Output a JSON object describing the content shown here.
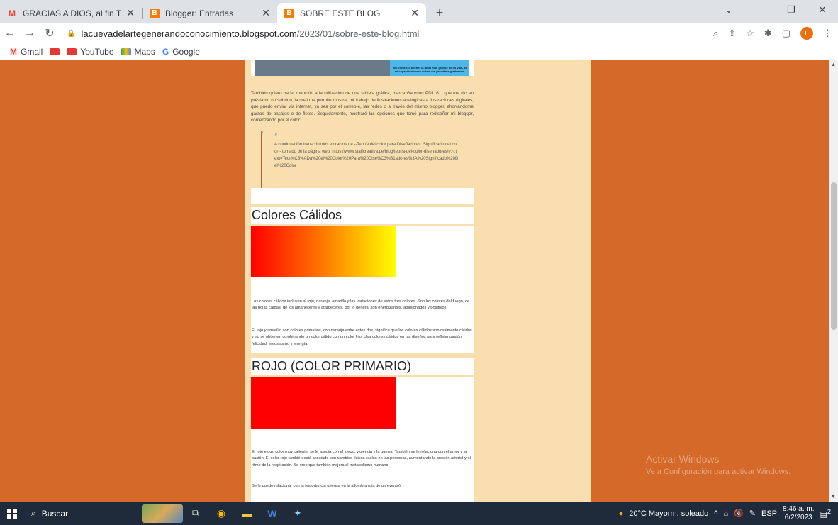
{
  "browser": {
    "tabs": [
      {
        "title": "GRACIAS A DIOS, al fin TDG LEL",
        "favicon": "gmail-icon",
        "active": false
      },
      {
        "title": "Blogger: Entradas",
        "favicon": "blogger-icon",
        "active": false
      },
      {
        "title": "SOBRE ESTE BLOG",
        "favicon": "blogger-icon",
        "active": true
      }
    ],
    "url_host": "lacuevadelartegenerandoconocimiento.blogspot.com",
    "url_path": "/2023/01/sobre-este-blog.html",
    "avatar_letter": "L",
    "bookmarks": [
      "Gmail",
      "YouTube",
      "Maps",
      "Google"
    ]
  },
  "post": {
    "image_caption": "Así comenzó a tener la duda más grande de mi vida, si mi capacidad como artista era permitirle graduarme",
    "intro_paragraph": "También quiero hacer mención a la utilización de una tableta gráfica, marca Gaomon PD1161, que me dio en préstamo un sobrino, la cual me permite mostrar mi trabajo de ilustraciones analógicas a ilustraciones digitales, que puedo enviar vía internet, ya sea por el correo-e, las redes o a través del mismo blogger, ahorrándome gastos de pasajes o de fletes. Seguidamente, mostraré las opciones que tomé para rediseñar mi blogger, comenzando por el color:",
    "quote_text": "A continuación transcribimos extractos de --Teoría del color para Diseñadores. Significado del color-- tomado de la página web: https://www.staffcreativa.pe/blog/teoria-del-color-disenadores/#:~:text=Teor%C3%ADa%20el%20Color%20Para%20Dise%C3%B1adores%3A%20Significado%20Del%20Color",
    "heading_warm": "Colores Cálidos",
    "warm_p1": "Los colores cálidos incluyen al rojo, naranja, amarillo y las variaciones de estos tres colores. Son los colores del fuego, de las hojas caídas, de los amaneceres y atardeceres, por lo general son energizantes, apasionados y positivos.",
    "warm_p2": "El rojo y amarillo son colores primarios, con naranja entre estos dos, significa que los colores cálidos son realmente cálidos y no se obtienen combinando un color cálido con un color frío. Usa colores cálidos en tus diseños para reflejar pasión, felicidad, entusiasmo y energía.",
    "heading_red": "ROJO (COLOR PRIMARIO)",
    "red_p1": "El rojo es un color muy caliente, se le asocia con el fuego, violencia y la guerra. También se le relaciona con el amor y la pasión. El color rojo también está asociado con cambios físicos reales en las personas, aumentando la presión arterial y el ritmo de la respiración. Se cree que también mejora el metabolismo humano.",
    "red_p2": "Se le puede relacionar con la importancia (piensa en la alfombra roja de un evento). ."
  },
  "watermark": {
    "title": "Activar Windows",
    "subtitle": "Ve a Configuración para activar Windows."
  },
  "taskbar": {
    "search_label": "Buscar",
    "weather": "20°C  Mayorm. soleado",
    "language": "ESP",
    "time": "8:46 a. m.",
    "date": "6/2/2023",
    "notifications": "2"
  },
  "colors": {
    "page_bg": "#d4692a",
    "column_bg": "#f9dfaf",
    "red_swatch": "#ff0000"
  }
}
